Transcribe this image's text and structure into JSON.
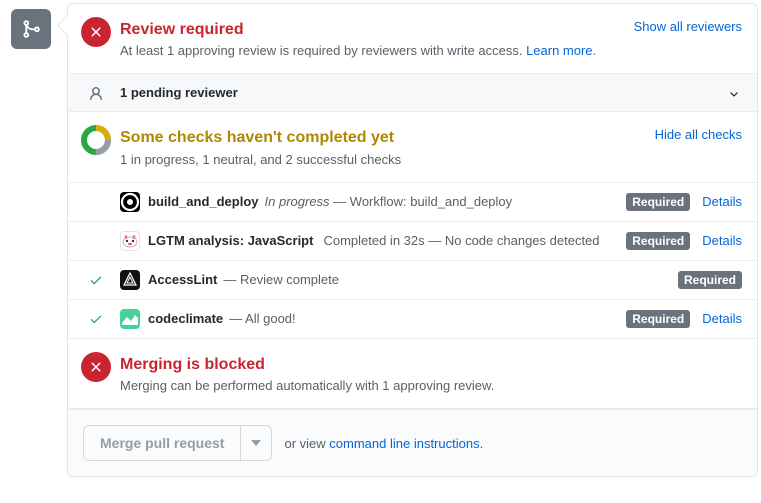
{
  "review": {
    "title": "Review required",
    "subtext_prefix": "At least 1 approving review is required by reviewers with write access. ",
    "learn_more": "Learn more",
    "show_all": "Show all reviewers"
  },
  "reviewer_bar": {
    "text": "1 pending reviewer"
  },
  "checks_header": {
    "title": "Some checks haven't completed yet",
    "subtext": "1 in progress, 1 neutral, and 2 successful checks",
    "hide_all": "Hide all checks"
  },
  "checks": [
    {
      "name": "build_and_deploy",
      "desc_italic": "In progress",
      "desc_rest": " — Workflow: build_and_deploy",
      "required": "Required",
      "details": "Details"
    },
    {
      "name": "LGTM analysis: JavaScript",
      "desc_italic": "",
      "desc_rest": "Completed in 32s — No code changes detected",
      "required": "Required",
      "details": "Details"
    },
    {
      "name": "AccessLint",
      "desc_italic": "",
      "desc_rest": " — Review complete",
      "required": "Required",
      "details": ""
    },
    {
      "name": "codeclimate",
      "desc_italic": "",
      "desc_rest": " — All good!",
      "required": "Required",
      "details": "Details"
    }
  ],
  "blocked": {
    "title": "Merging is blocked",
    "subtext": "Merging can be performed automatically with 1 approving review."
  },
  "footer": {
    "merge_btn": "Merge pull request",
    "or_view": "or view ",
    "cli": "command line instructions",
    "period": "."
  }
}
